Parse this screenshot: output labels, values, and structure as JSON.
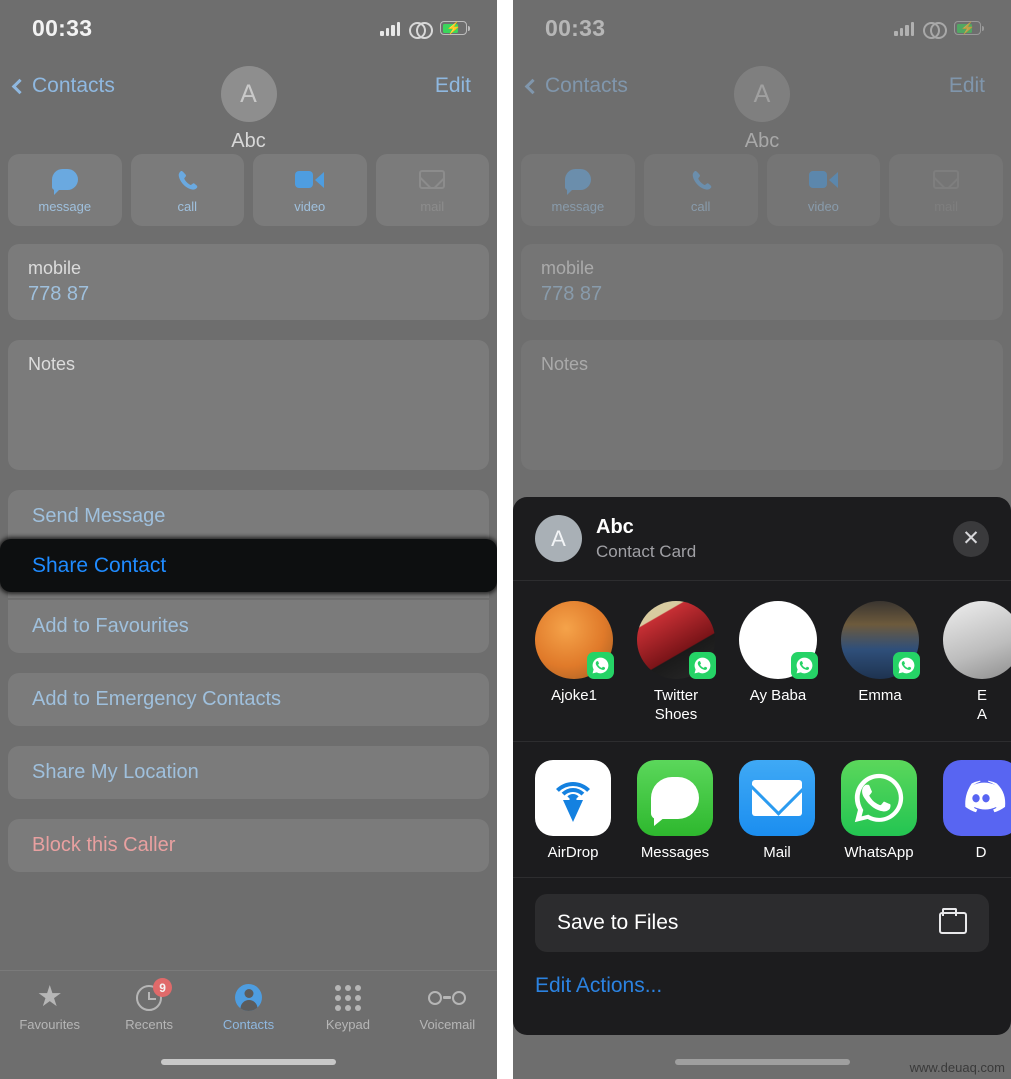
{
  "status_bar": {
    "time": "00:33",
    "signal_icon": "cellular-signal-icon",
    "link_icon": "link-chain-icon",
    "battery_icon": "battery-charging-icon",
    "battery_charging": true
  },
  "nav": {
    "back_label": "Contacts",
    "edit_label": "Edit"
  },
  "contact": {
    "initial": "A",
    "name": "Abc",
    "quick_actions": [
      {
        "label": "message",
        "icon": "message-bubble-icon",
        "enabled": true
      },
      {
        "label": "call",
        "icon": "phone-handset-icon",
        "enabled": true
      },
      {
        "label": "video",
        "icon": "video-camera-icon",
        "enabled": true
      },
      {
        "label": "mail",
        "icon": "mail-envelope-icon",
        "enabled": false
      }
    ],
    "phone_field": {
      "label": "mobile",
      "value": "778 87"
    },
    "notes_label": "Notes"
  },
  "actions": {
    "group1": [
      {
        "label": "Send Message",
        "style": "blue"
      },
      {
        "label": "Share Contact",
        "style": "blue",
        "highlighted": true
      },
      {
        "label": "Add to Favourites",
        "style": "blue"
      }
    ],
    "group2": [
      {
        "label": "Add to Emergency Contacts",
        "style": "blue"
      }
    ],
    "group3": [
      {
        "label": "Share My Location",
        "style": "blue"
      }
    ],
    "group4": [
      {
        "label": "Block this Caller",
        "style": "red"
      }
    ]
  },
  "tabbar": {
    "items": [
      {
        "label": "Favourites",
        "icon": "star-icon",
        "active": false,
        "badge": null
      },
      {
        "label": "Recents",
        "icon": "clock-icon",
        "active": false,
        "badge": "9"
      },
      {
        "label": "Contacts",
        "icon": "person-circle-icon",
        "active": true,
        "badge": null
      },
      {
        "label": "Keypad",
        "icon": "keypad-dots-icon",
        "active": false,
        "badge": null
      },
      {
        "label": "Voicemail",
        "icon": "voicemail-icon",
        "active": false,
        "badge": null
      }
    ]
  },
  "share_sheet": {
    "title": "Abc",
    "subtitle": "Contact Card",
    "avatar_initial": "A",
    "close_icon": "close-x-icon",
    "people": [
      {
        "name": "Ajoke1",
        "badge_app": "whatsapp-icon",
        "avatar_kind": "food-photo"
      },
      {
        "name": "Twitter\nShoes",
        "badge_app": "whatsapp-icon",
        "avatar_kind": "shoe-photo"
      },
      {
        "name": "Ay Baba",
        "badge_app": "whatsapp-icon",
        "avatar_kind": "blank-white"
      },
      {
        "name": "Emma",
        "badge_app": "whatsapp-icon",
        "avatar_kind": "person-photo"
      },
      {
        "name": "E\nA",
        "badge_app": "whatsapp-icon",
        "avatar_kind": "photo-partial"
      }
    ],
    "apps": [
      {
        "name": "AirDrop",
        "icon": "airdrop-icon"
      },
      {
        "name": "Messages",
        "icon": "messages-icon"
      },
      {
        "name": "Mail",
        "icon": "mail-icon"
      },
      {
        "name": "WhatsApp",
        "icon": "whatsapp-icon"
      },
      {
        "name": "D",
        "icon": "discord-icon"
      }
    ],
    "save_to_files": {
      "label": "Save to Files",
      "icon": "folder-icon"
    },
    "edit_actions_label": "Edit Actions..."
  },
  "watermark": "www.deuaq.com",
  "colors": {
    "screen_bg": "#6e6e6e",
    "card_bg": "#7b7b7b",
    "accent_blue": "#9fc0dd",
    "highlight_blue": "#1f8bff",
    "highlight_bg": "#0d0f10",
    "danger_red": "#e8a0a0",
    "sheet_bg": "#1c1c1e",
    "whatsapp_green": "#25d366",
    "badge_red": "#e06a6a"
  }
}
